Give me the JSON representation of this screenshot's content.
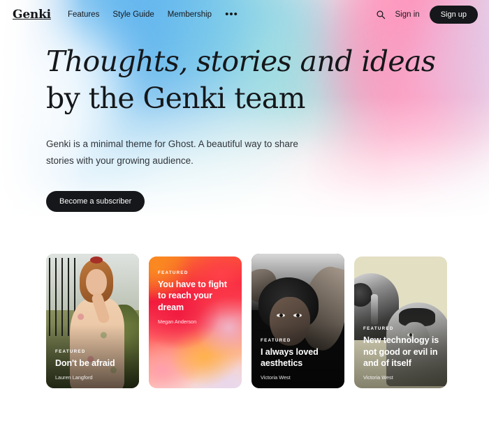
{
  "site": {
    "brand": "Genki",
    "accent_dark": "#15171a"
  },
  "header": {
    "nav": [
      {
        "label": "Features"
      },
      {
        "label": "Style Guide"
      },
      {
        "label": "Membership"
      }
    ],
    "more_label": "•••",
    "search_icon": "search-icon",
    "signin_label": "Sign in",
    "signup_label": "Sign up"
  },
  "hero": {
    "headline_italic": "Thoughts, stories and ideas",
    "headline_rest": " by the Genki team",
    "subtitle": "Genki is a minimal theme for Ghost. A beautiful way to share stories with your growing audience.",
    "cta_label": "Become a subscriber"
  },
  "cards": [
    {
      "tag": "FEATURED",
      "title": "Don't be afraid",
      "author": "Lauren Langford",
      "kind": "photo-woman-dress",
      "text_position": "bottom"
    },
    {
      "tag": "FEATURED",
      "title": "You have to fight to reach your dream",
      "author": "Megan Anderson",
      "kind": "gradient-orange-red",
      "text_position": "top",
      "gradient_colors": [
        "#fa8a21",
        "#f21a3d",
        "#ff5a62",
        "#ffb07e",
        "#ece2ee"
      ]
    },
    {
      "tag": "FEATURED",
      "title": "I always loved aesthetics",
      "author": "Victoria West",
      "kind": "photo-bw-portrait",
      "text_position": "bottom"
    },
    {
      "tag": "FEATURED",
      "title": "New technology is not good or evil in and of itself",
      "author": "Victoria West",
      "kind": "beige-arches",
      "text_position": "bottom",
      "background_color": "#e3dfc3"
    }
  ]
}
